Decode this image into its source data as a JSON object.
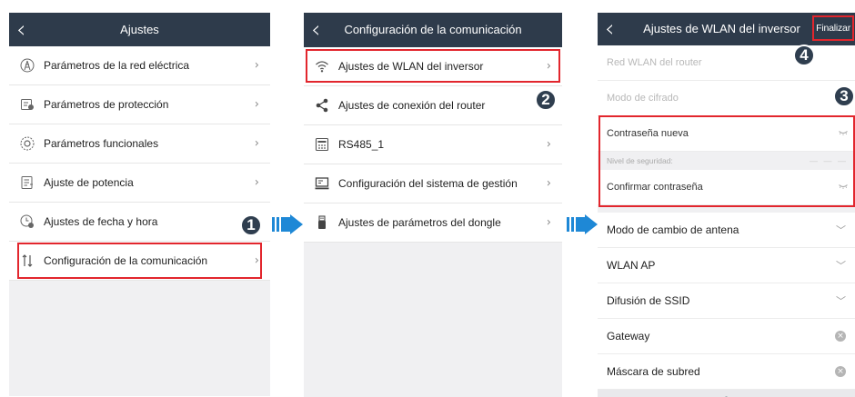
{
  "screen1": {
    "back": "‹",
    "title": "Ajustes",
    "items": [
      {
        "icon": "grid-tower-icon",
        "label": "Parámetros de la red eléctrica",
        "chev": "›"
      },
      {
        "icon": "protection-icon",
        "label": "Parámetros de protección",
        "chev": "›"
      },
      {
        "icon": "gear-circle-icon",
        "label": "Parámetros funcionales",
        "chev": "›"
      },
      {
        "icon": "power-doc-icon",
        "label": "Ajuste de potencia",
        "chev": "›"
      },
      {
        "icon": "clock-gear-icon",
        "label": "Ajustes de fecha y hora",
        "chev": ""
      },
      {
        "icon": "sort-arrows-icon",
        "label": "Configuración de la comunicación",
        "chev": "›"
      }
    ],
    "step": "1"
  },
  "screen2": {
    "back": "‹",
    "title": "Configuración de la comunicación",
    "items": [
      {
        "icon": "wifi-icon",
        "label": "Ajustes de WLAN del inversor",
        "chev": "›"
      },
      {
        "icon": "share-icon",
        "label": "Ajustes de conexión del router",
        "chev": ""
      },
      {
        "icon": "rs485-icon",
        "label": "RS485_1",
        "chev": "›"
      },
      {
        "icon": "monitor-icon",
        "label": "Configuración del sistema de gestión",
        "chev": "›"
      },
      {
        "icon": "dongle-icon",
        "label": "Ajustes de parámetros del dongle",
        "chev": "›"
      }
    ],
    "step": "2"
  },
  "screen3": {
    "back": "‹",
    "title": "Ajustes de WLAN del inversor",
    "done": "Finalizar",
    "router_wlan": "Red WLAN del router",
    "cipher": "Modo de cifrado",
    "new_password": "Contraseña nueva",
    "security_level": "Nivel de seguridad:",
    "confirm_password": "Confirmar contraseña",
    "antenna": "Modo de cambio de antena",
    "wlan_ap": "WLAN AP",
    "ssid": "Difusión de SSID",
    "gateway": "Gateway",
    "subnet": "Máscara de subred",
    "chev_down": "﹀",
    "clear": "×",
    "up": "︿",
    "step3": "3",
    "step4": "4"
  },
  "colors": {
    "header": "#2e3b4b",
    "highlight": "#e2262d",
    "arrow": "#1e88d6",
    "badge": "#2f3e4f"
  }
}
